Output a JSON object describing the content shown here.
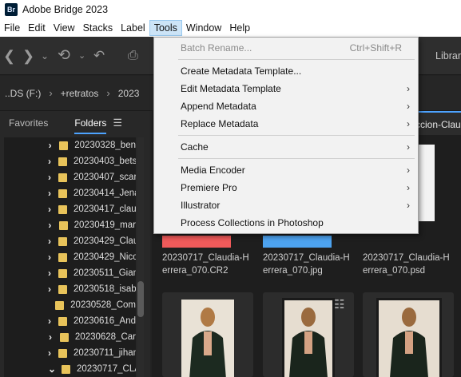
{
  "window": {
    "logo": "Br",
    "title": "Adobe Bridge 2023"
  },
  "menubar": {
    "items": [
      "File",
      "Edit",
      "View",
      "Stacks",
      "Label",
      "Tools",
      "Window",
      "Help"
    ]
  },
  "toolbar": {
    "icons": [
      "back-icon",
      "forward-icon",
      "chevron-down-icon",
      "history-icon",
      "boomerang-icon",
      "camera-download-icon"
    ],
    "library_label": "Librar"
  },
  "pathbar": {
    "crumbs": [
      "..DS (F:)",
      "+retratos",
      "2023"
    ]
  },
  "left_panel": {
    "tabs": [
      "Favorites",
      "Folders"
    ],
    "folders": [
      {
        "name": "20230328_ben",
        "expanded": false
      },
      {
        "name": "20230403_bets",
        "expanded": false
      },
      {
        "name": "20230407_scar",
        "expanded": false
      },
      {
        "name": "20230414_Jena",
        "expanded": false
      },
      {
        "name": "20230417_clau",
        "expanded": false
      },
      {
        "name": "20230419_mar",
        "expanded": false
      },
      {
        "name": "20230429_Clau",
        "expanded": false
      },
      {
        "name": "20230429_Nico",
        "expanded": false
      },
      {
        "name": "20230511_Gian",
        "expanded": false
      },
      {
        "name": "20230518_isab",
        "expanded": false
      },
      {
        "name": "20230528_Com",
        "expanded": null
      },
      {
        "name": "20230616_And",
        "expanded": false
      },
      {
        "name": "20230628_Car",
        "expanded": false
      },
      {
        "name": "20230711_jihan",
        "expanded": false
      },
      {
        "name": "20230717_CLAU",
        "expanded": true
      }
    ]
  },
  "content": {
    "tab_label": "ccion-Claud",
    "files": [
      {
        "name": "20230717_Claudia-Herrera_070.CR2",
        "label_color": "#f05a5a"
      },
      {
        "name": "20230717_Claudia-Herrera_070.jpg",
        "label_color": "#4da3f0"
      },
      {
        "name": "20230717_Claudia-Herrera_070.psd",
        "label_color": ""
      }
    ]
  },
  "tools_menu": {
    "items": [
      {
        "label": "Batch Rename...",
        "shortcut": "Ctrl+Shift+R",
        "disabled": true,
        "submenu": false
      },
      {
        "label": "Create Metadata Template...",
        "shortcut": "",
        "disabled": false,
        "submenu": false
      },
      {
        "label": "Edit Metadata Template",
        "shortcut": "",
        "disabled": false,
        "submenu": true
      },
      {
        "label": "Append Metadata",
        "shortcut": "",
        "disabled": false,
        "submenu": true
      },
      {
        "label": "Replace Metadata",
        "shortcut": "",
        "disabled": false,
        "submenu": true
      },
      {
        "label": "Cache",
        "shortcut": "",
        "disabled": false,
        "submenu": true
      },
      {
        "label": "Media Encoder",
        "shortcut": "",
        "disabled": false,
        "submenu": true
      },
      {
        "label": "Premiere Pro",
        "shortcut": "",
        "disabled": false,
        "submenu": true
      },
      {
        "label": "Illustrator",
        "shortcut": "",
        "disabled": false,
        "submenu": true
      },
      {
        "label": "Process Collections in Photoshop",
        "shortcut": "",
        "disabled": false,
        "submenu": false
      }
    ]
  }
}
